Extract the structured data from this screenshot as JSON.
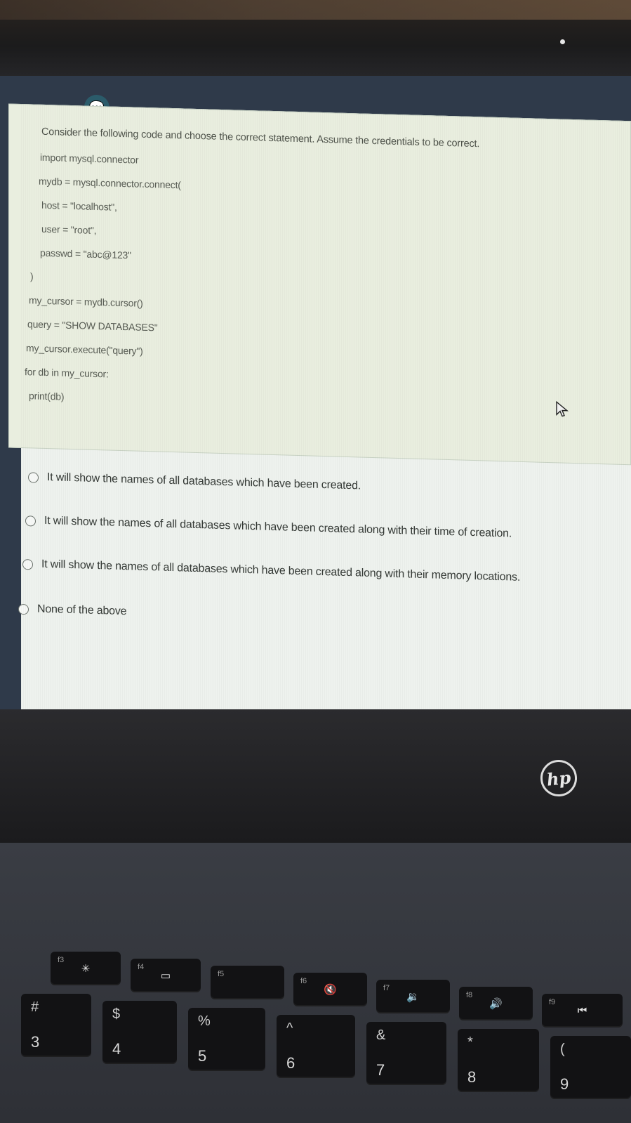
{
  "question": {
    "prompt": "Consider the following code and choose the correct statement. Assume the credentials to be correct.",
    "code_lines": [
      "import mysql.connector",
      "mydb = mysql.connector.connect(",
      "host = \"localhost\",",
      "user = \"root\",",
      "passwd = \"abc@123\"",
      ")",
      "my_cursor = mydb.cursor()",
      "query = \"SHOW DATABASES\"",
      "my_cursor.execute(\"query\")",
      "for db in my_cursor:",
      "print(db)"
    ]
  },
  "options": [
    {
      "label": "It will show the names of all databases which have been created.",
      "selected": false
    },
    {
      "label": "It will show the names of all databases which have been created along with their time of creation.",
      "selected": false
    },
    {
      "label": "It will show the names of all databases which have been created along with their memory locations.",
      "selected": false
    },
    {
      "label": "None of the above",
      "selected": false
    }
  ],
  "brand": {
    "logo": "hp"
  },
  "keyboard": {
    "fn_keys": [
      {
        "fn": "f3",
        "icon": "✳"
      },
      {
        "fn": "f4",
        "icon": "▭"
      },
      {
        "fn": "f5",
        "icon": ""
      },
      {
        "fn": "f6",
        "icon": "🔇"
      },
      {
        "fn": "f7",
        "icon": "🔉"
      },
      {
        "fn": "f8",
        "icon": "🔊"
      },
      {
        "fn": "f9",
        "icon": "⏮"
      }
    ],
    "num_keys": [
      {
        "sym": "#",
        "num": "3"
      },
      {
        "sym": "$",
        "num": "4"
      },
      {
        "sym": "%",
        "num": "5"
      },
      {
        "sym": "^",
        "num": "6"
      },
      {
        "sym": "&",
        "num": "7"
      },
      {
        "sym": "*",
        "num": "8"
      },
      {
        "sym": "(",
        "num": "9"
      }
    ]
  },
  "colors": {
    "accent_icon": "#2b5b6a",
    "question_bg": "#e9eedf",
    "screen_bg": "#eef2ee"
  }
}
